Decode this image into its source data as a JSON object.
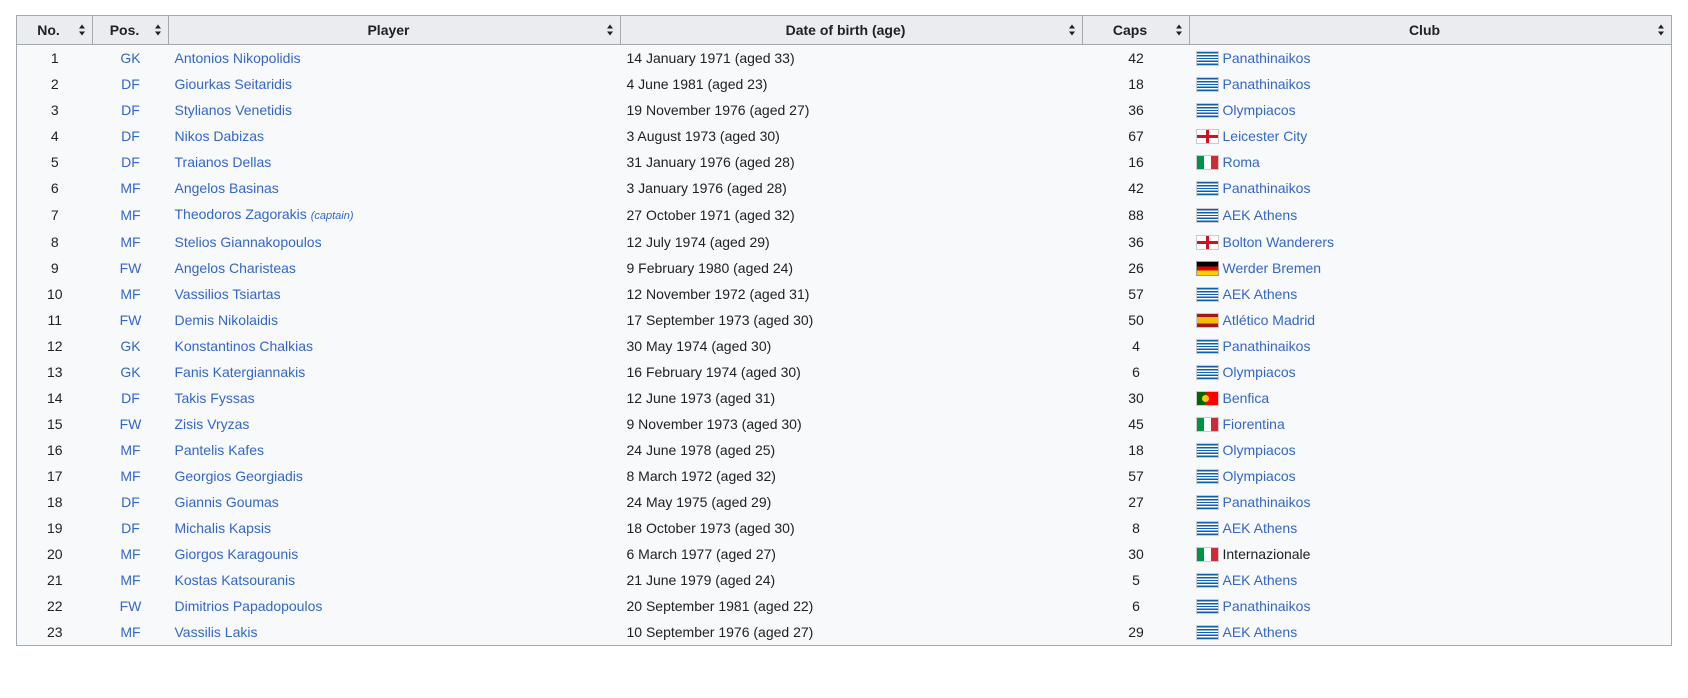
{
  "headers": {
    "no": "No.",
    "pos": "Pos.",
    "player": "Player",
    "dob": "Date of birth (age)",
    "caps": "Caps",
    "club": "Club"
  },
  "players": [
    {
      "no": "1",
      "pos": "GK",
      "name": "Antonios Nikopolidis",
      "note": "",
      "dob": "14 January 1971 (aged 33)",
      "caps": "42",
      "flag": "greece-flag",
      "club": "Panathinaikos",
      "club_linked": true
    },
    {
      "no": "2",
      "pos": "DF",
      "name": "Giourkas Seitaridis",
      "note": "",
      "dob": "4 June 1981 (aged 23)",
      "caps": "18",
      "flag": "greece-flag",
      "club": "Panathinaikos",
      "club_linked": true
    },
    {
      "no": "3",
      "pos": "DF",
      "name": "Stylianos Venetidis",
      "note": "",
      "dob": "19 November 1976 (aged 27)",
      "caps": "36",
      "flag": "greece-flag",
      "club": "Olympiacos",
      "club_linked": true
    },
    {
      "no": "4",
      "pos": "DF",
      "name": "Nikos Dabizas",
      "note": "",
      "dob": "3 August 1973 (aged 30)",
      "caps": "67",
      "flag": "england-flag",
      "club": "Leicester City",
      "club_linked": true
    },
    {
      "no": "5",
      "pos": "DF",
      "name": "Traianos Dellas",
      "note": "",
      "dob": "31 January 1976 (aged 28)",
      "caps": "16",
      "flag": "italy-flag",
      "club": "Roma",
      "club_linked": true
    },
    {
      "no": "6",
      "pos": "MF",
      "name": "Angelos Basinas",
      "note": "",
      "dob": "3 January 1976 (aged 28)",
      "caps": "42",
      "flag": "greece-flag",
      "club": "Panathinaikos",
      "club_linked": true
    },
    {
      "no": "7",
      "pos": "MF",
      "name": "Theodoros Zagorakis",
      "note": "(captain)",
      "dob": "27 October 1971 (aged 32)",
      "caps": "88",
      "flag": "greece-flag",
      "club": "AEK Athens",
      "club_linked": true
    },
    {
      "no": "8",
      "pos": "MF",
      "name": "Stelios Giannakopoulos",
      "note": "",
      "dob": "12 July 1974 (aged 29)",
      "caps": "36",
      "flag": "england-flag",
      "club": "Bolton Wanderers",
      "club_linked": true
    },
    {
      "no": "9",
      "pos": "FW",
      "name": "Angelos Charisteas",
      "note": "",
      "dob": "9 February 1980 (aged 24)",
      "caps": "26",
      "flag": "germany-flag",
      "club": "Werder Bremen",
      "club_linked": true
    },
    {
      "no": "10",
      "pos": "MF",
      "name": "Vassilios Tsiartas",
      "note": "",
      "dob": "12 November 1972 (aged 31)",
      "caps": "57",
      "flag": "greece-flag",
      "club": "AEK Athens",
      "club_linked": true
    },
    {
      "no": "11",
      "pos": "FW",
      "name": "Demis Nikolaidis",
      "note": "",
      "dob": "17 September 1973 (aged 30)",
      "caps": "50",
      "flag": "spain-flag",
      "club": "Atlético Madrid",
      "club_linked": true
    },
    {
      "no": "12",
      "pos": "GK",
      "name": "Konstantinos Chalkias",
      "note": "",
      "dob": "30 May 1974 (aged 30)",
      "caps": "4",
      "flag": "greece-flag",
      "club": "Panathinaikos",
      "club_linked": true
    },
    {
      "no": "13",
      "pos": "GK",
      "name": "Fanis Katergiannakis",
      "note": "",
      "dob": "16 February 1974 (aged 30)",
      "caps": "6",
      "flag": "greece-flag",
      "club": "Olympiacos",
      "club_linked": true
    },
    {
      "no": "14",
      "pos": "DF",
      "name": "Takis Fyssas",
      "note": "",
      "dob": "12 June 1973 (aged 31)",
      "caps": "30",
      "flag": "portugal-flag",
      "club": "Benfica",
      "club_linked": true
    },
    {
      "no": "15",
      "pos": "FW",
      "name": "Zisis Vryzas",
      "note": "",
      "dob": "9 November 1973 (aged 30)",
      "caps": "45",
      "flag": "italy-flag",
      "club": "Fiorentina",
      "club_linked": true
    },
    {
      "no": "16",
      "pos": "MF",
      "name": "Pantelis Kafes",
      "note": "",
      "dob": "24 June 1978 (aged 25)",
      "caps": "18",
      "flag": "greece-flag",
      "club": "Olympiacos",
      "club_linked": true
    },
    {
      "no": "17",
      "pos": "MF",
      "name": "Georgios Georgiadis",
      "note": "",
      "dob": "8 March 1972 (aged 32)",
      "caps": "57",
      "flag": "greece-flag",
      "club": "Olympiacos",
      "club_linked": true
    },
    {
      "no": "18",
      "pos": "DF",
      "name": "Giannis Goumas",
      "note": "",
      "dob": "24 May 1975 (aged 29)",
      "caps": "27",
      "flag": "greece-flag",
      "club": "Panathinaikos",
      "club_linked": true
    },
    {
      "no": "19",
      "pos": "DF",
      "name": "Michalis Kapsis",
      "note": "",
      "dob": "18 October 1973 (aged 30)",
      "caps": "8",
      "flag": "greece-flag",
      "club": "AEK Athens",
      "club_linked": true
    },
    {
      "no": "20",
      "pos": "MF",
      "name": "Giorgos Karagounis",
      "note": "",
      "dob": "6 March 1977 (aged 27)",
      "caps": "30",
      "flag": "italy-flag",
      "club": "Internazionale",
      "club_linked": false
    },
    {
      "no": "21",
      "pos": "MF",
      "name": "Kostas Katsouranis",
      "note": "",
      "dob": "21 June 1979 (aged 24)",
      "caps": "5",
      "flag": "greece-flag",
      "club": "AEK Athens",
      "club_linked": true
    },
    {
      "no": "22",
      "pos": "FW",
      "name": "Dimitrios Papadopoulos",
      "note": "",
      "dob": "20 September 1981 (aged 22)",
      "caps": "6",
      "flag": "greece-flag",
      "club": "Panathinaikos",
      "club_linked": true
    },
    {
      "no": "23",
      "pos": "MF",
      "name": "Vassilis Lakis",
      "note": "",
      "dob": "10 September 1976 (aged 27)",
      "caps": "29",
      "flag": "greece-flag",
      "club": "AEK Athens",
      "club_linked": true
    }
  ]
}
